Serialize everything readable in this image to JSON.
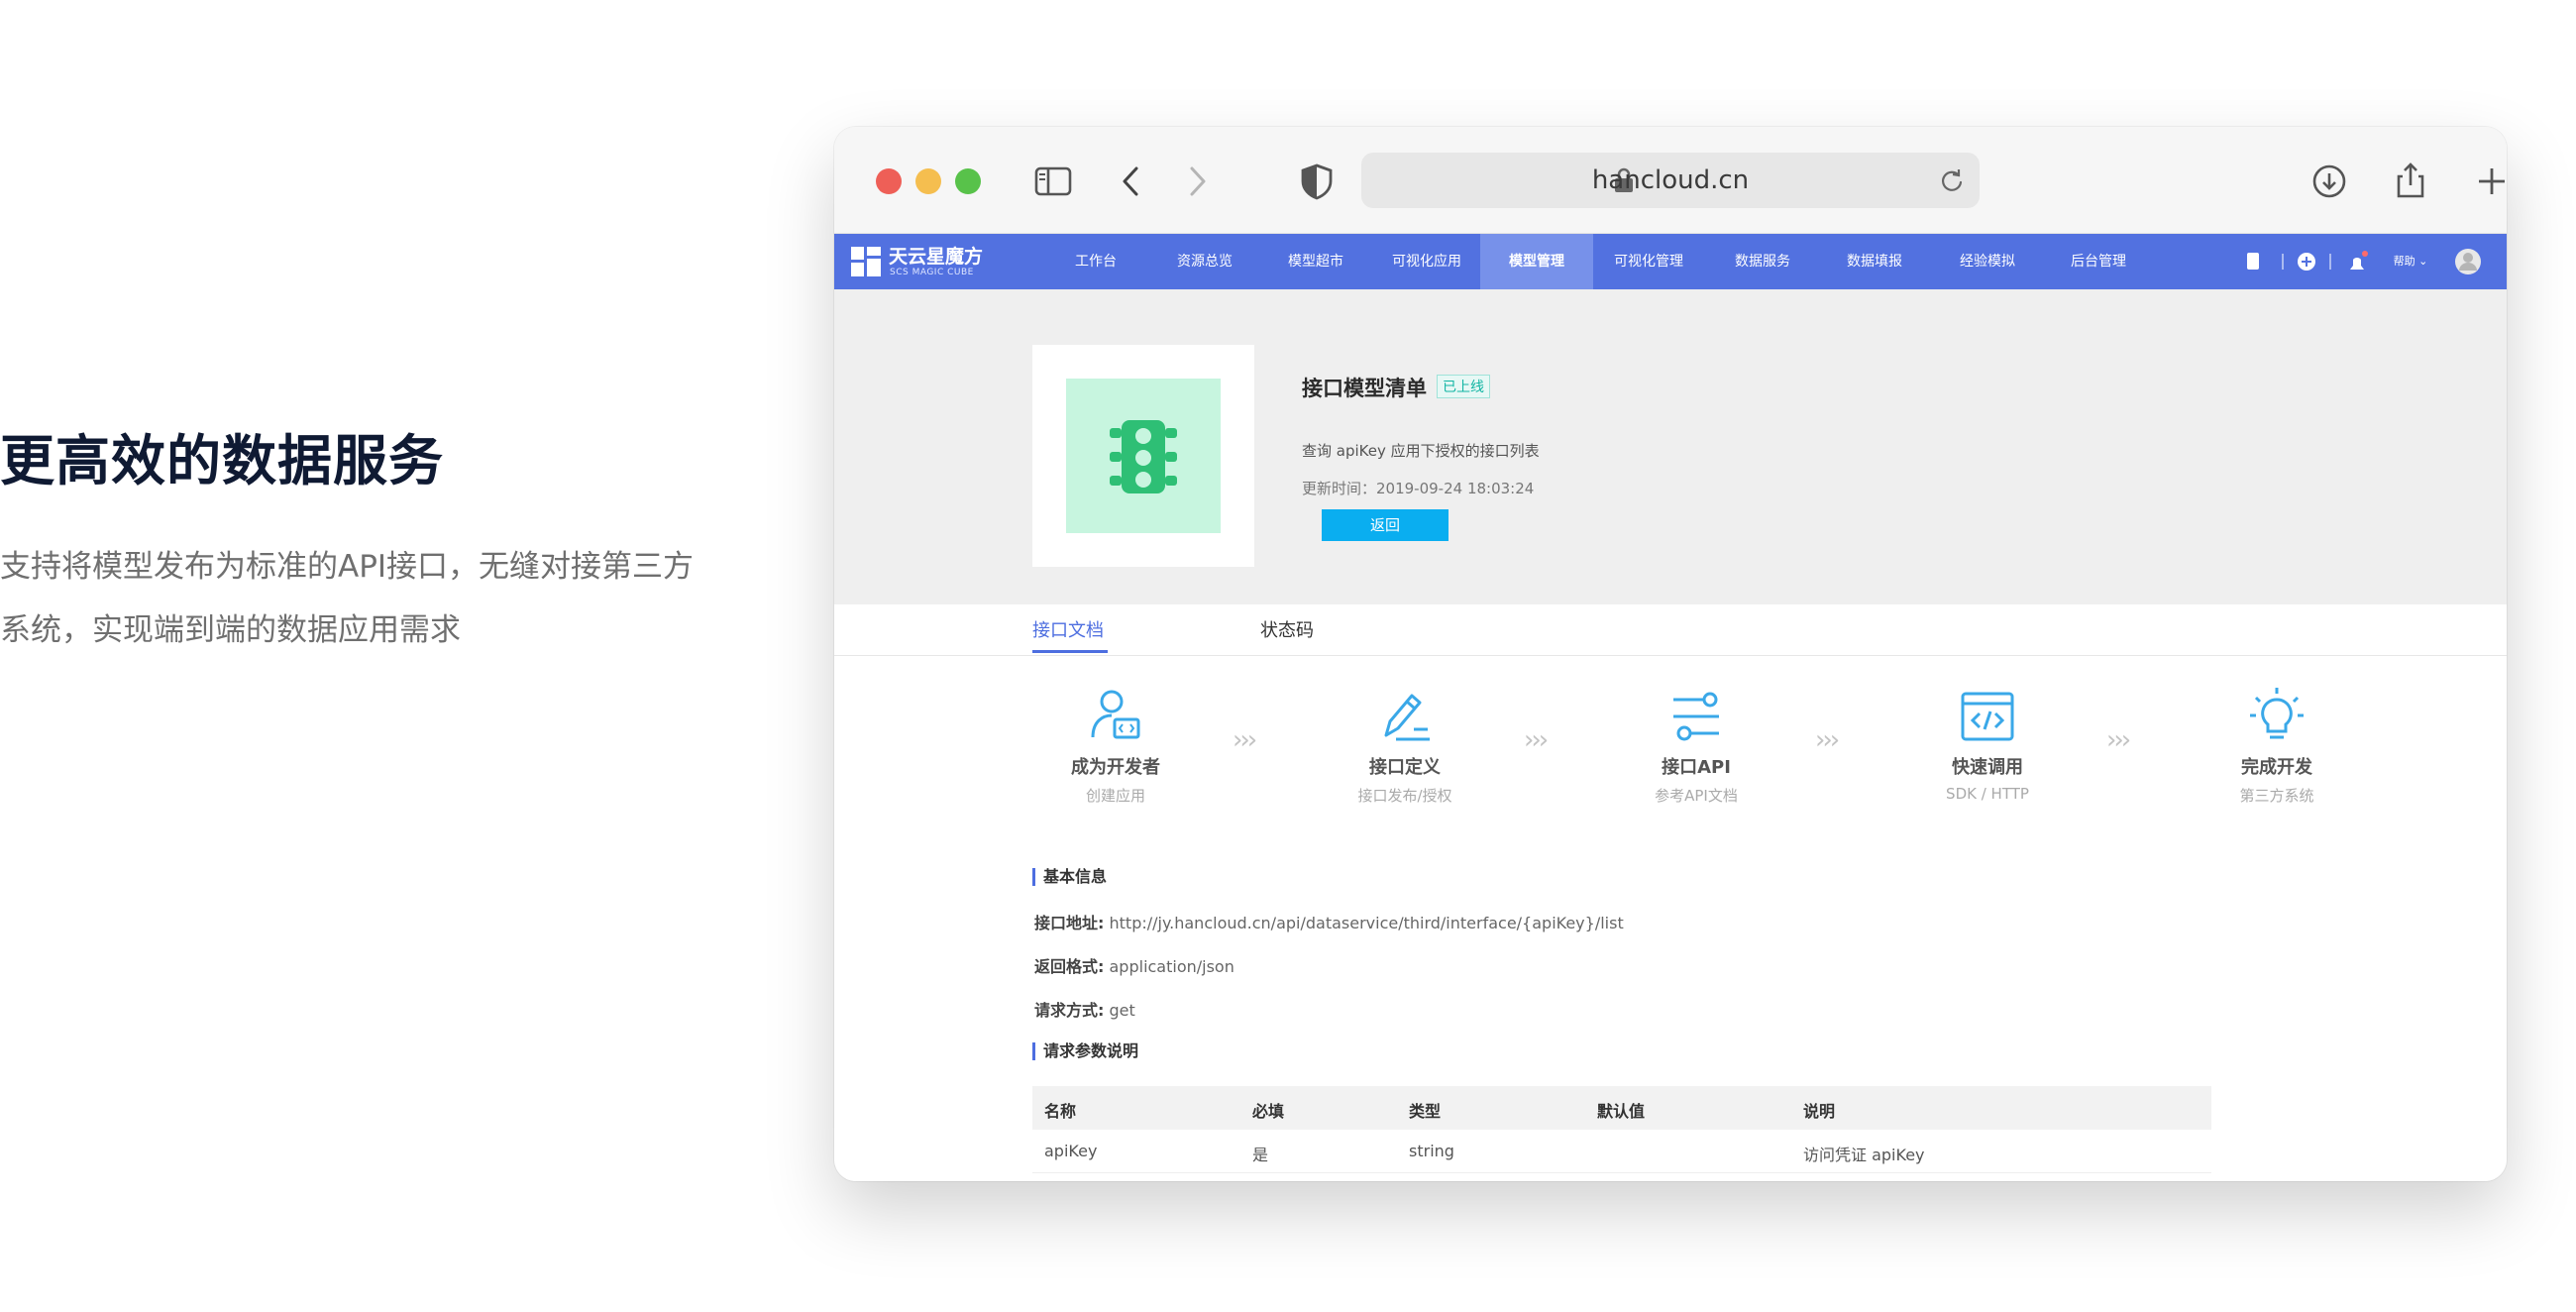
{
  "hero": {
    "title": "更高效的数据服务",
    "description": "支持将模型发布为标准的API接口，无缝对接第三方系统，实现端到端的数据应用需求"
  },
  "browser": {
    "url": "hancloud.cn"
  },
  "app": {
    "logo": {
      "name": "天云星魔方",
      "sub": "SCS MAGIC CUBE"
    },
    "nav": [
      "工作台",
      "资源总览",
      "模型超市",
      "可视化应用",
      "模型管理",
      "可视化管理",
      "数据服务",
      "数据填报",
      "经验模拟",
      "后台管理"
    ],
    "nav_active": "模型管理",
    "help_label": "帮助",
    "colors": {
      "nav_bg": "#5271e0",
      "accent": "#4d6ee0",
      "button": "#0aaef0",
      "status_green": "#11b5a3"
    }
  },
  "model": {
    "title": "接口模型清单",
    "status": "已上线",
    "description": "查询 apiKey 应用下授权的接口列表",
    "updated": "更新时间：2019-09-24 18:03:24",
    "back_label": "返回"
  },
  "tabs": [
    {
      "label": "接口文档",
      "active": true
    },
    {
      "label": "状态码",
      "active": false
    }
  ],
  "steps": [
    {
      "icon": "developer-icon",
      "title": "成为开发者",
      "subtitle": "创建应用"
    },
    {
      "icon": "pen-icon",
      "title": "接口定义",
      "subtitle": "接口发布/授权"
    },
    {
      "icon": "sliders-icon",
      "title": "接口API",
      "subtitle": "参考API文档"
    },
    {
      "icon": "code-window-icon",
      "title": "快速调用",
      "subtitle": "SDK / HTTP"
    },
    {
      "icon": "lightbulb-icon",
      "title": "完成开发",
      "subtitle": "第三方系统"
    }
  ],
  "basic_info": {
    "heading": "基本信息",
    "url_label": "接口地址:",
    "url_value": "http://jy.hancloud.cn/api/dataservice/third/interface/{apiKey}/list",
    "format_label": "返回格式:",
    "format_value": "application/json",
    "method_label": "请求方式:",
    "method_value": "get"
  },
  "params": {
    "heading": "请求参数说明",
    "columns": [
      "名称",
      "必填",
      "类型",
      "默认值",
      "说明"
    ],
    "rows": [
      [
        "apiKey",
        "是",
        "string",
        "",
        "访问凭证 apiKey"
      ]
    ]
  }
}
